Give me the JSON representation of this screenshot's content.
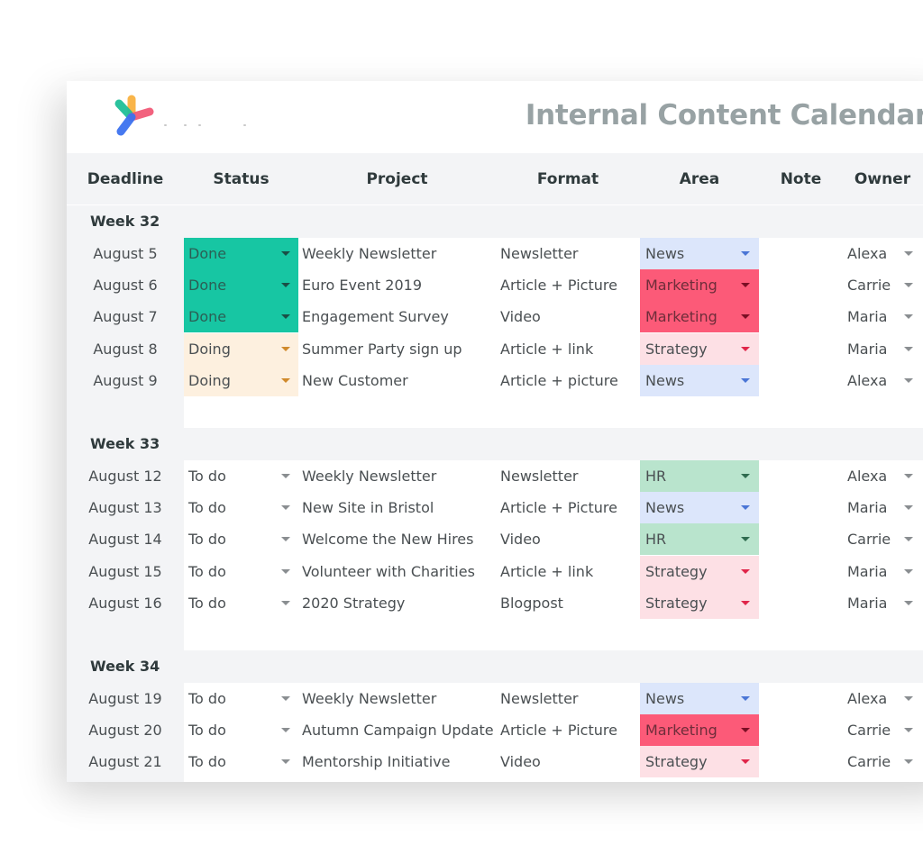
{
  "header": {
    "title": "Internal Content Calendar",
    "logo": "pinwheel-logo"
  },
  "columns": [
    "Deadline",
    "Status",
    "Project",
    "Format",
    "Area",
    "Note",
    "Owner"
  ],
  "colors": {
    "status": {
      "Done": {
        "bg": "#17c6a3",
        "arrow": "#1a4f46",
        "text": "#2b5f55"
      },
      "Doing": {
        "bg": "#fdf0df",
        "arrow": "#d08a2c",
        "text": "#4a4f52"
      },
      "To do": {
        "bg": "#ffffff",
        "arrow": "#8a8e91",
        "text": "#4a4f52"
      }
    },
    "area": {
      "News": {
        "bg": "#dce6fb",
        "arrow": "#4b76d6",
        "text": "#4a4f52"
      },
      "Marketing": {
        "bg": "#fc5a78",
        "arrow": "#7a0f24",
        "text": "#6e2d3a"
      },
      "Strategy": {
        "bg": "#fde0e5",
        "arrow": "#e0264a",
        "text": "#4a4f52"
      },
      "HR": {
        "bg": "#b9e4cd",
        "arrow": "#2f6b4f",
        "text": "#4a4f52"
      }
    }
  },
  "weeks": [
    {
      "label": "Week 32",
      "rows": [
        {
          "deadline": "August 5",
          "status": "Done",
          "project": "Weekly Newsletter",
          "format": "Newsletter",
          "area": "News",
          "note": "",
          "owner": "Alexa"
        },
        {
          "deadline": "August 6",
          "status": "Done",
          "project": "Euro Event 2019",
          "format": "Article + Picture",
          "area": "Marketing",
          "note": "",
          "owner": "Carrie"
        },
        {
          "deadline": "August 7",
          "status": "Done",
          "project": "Engagement Survey",
          "format": "Video",
          "area": "Marketing",
          "note": "",
          "owner": "Maria"
        },
        {
          "deadline": "August 8",
          "status": "Doing",
          "project": "Summer Party sign up",
          "format": "Article + link",
          "area": "Strategy",
          "note": "",
          "owner": "Maria"
        },
        {
          "deadline": "August 9",
          "status": "Doing",
          "project": "New Customer",
          "format": "Article + picture",
          "area": "News",
          "note": "",
          "owner": "Alexa"
        }
      ]
    },
    {
      "label": "Week 33",
      "rows": [
        {
          "deadline": "August 12",
          "status": "To do",
          "project": "Weekly Newsletter",
          "format": "Newsletter",
          "area": "HR",
          "note": "",
          "owner": "Alexa"
        },
        {
          "deadline": "August 13",
          "status": "To do",
          "project": "New Site in Bristol",
          "format": "Article + Picture",
          "area": "News",
          "note": "",
          "owner": "Maria"
        },
        {
          "deadline": "August 14",
          "status": "To do",
          "project": "Welcome the New Hires",
          "format": "Video",
          "area": "HR",
          "note": "",
          "owner": "Carrie"
        },
        {
          "deadline": "August 15",
          "status": "To do",
          "project": "Volunteer with Charities",
          "format": "Article + link",
          "area": "Strategy",
          "note": "",
          "owner": "Maria"
        },
        {
          "deadline": "August 16",
          "status": "To do",
          "project": "2020 Strategy",
          "format": "Blogpost",
          "area": "Strategy",
          "note": "",
          "owner": "Maria"
        }
      ]
    },
    {
      "label": "Week 34",
      "rows": [
        {
          "deadline": "August 19",
          "status": "To do",
          "project": "Weekly Newsletter",
          "format": "Newsletter",
          "area": "News",
          "note": "",
          "owner": "Alexa"
        },
        {
          "deadline": "August 20",
          "status": "To do",
          "project": "Autumn Campaign Update",
          "format": "Article + Picture",
          "area": "Marketing",
          "note": "",
          "owner": "Carrie"
        },
        {
          "deadline": "August 21",
          "status": "To do",
          "project": "Mentorship Initiative",
          "format": "Video",
          "area": "Strategy",
          "note": "",
          "owner": "Carrie"
        }
      ]
    }
  ]
}
